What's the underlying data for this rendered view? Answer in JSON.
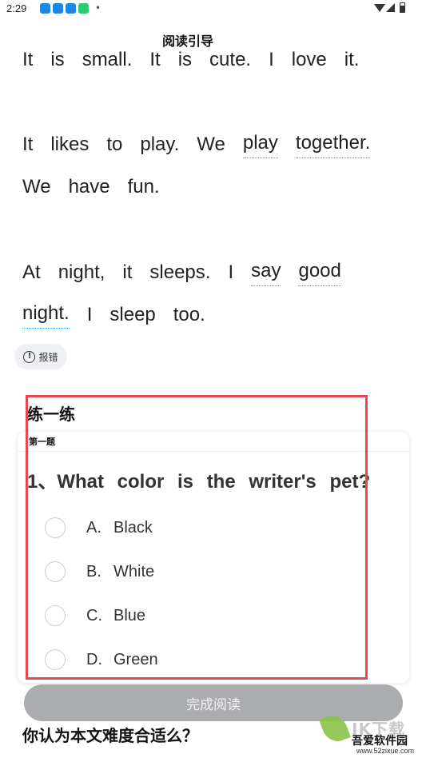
{
  "status_bar": {
    "time": "2:29",
    "dot": "•"
  },
  "header": {
    "title": "阅读引导"
  },
  "passage": {
    "lines": [
      {
        "words": [
          {
            "t": "It"
          },
          {
            "t": "is"
          },
          {
            "t": "small."
          },
          {
            "t": "It"
          },
          {
            "t": "is"
          },
          {
            "t": "cute."
          },
          {
            "t": "I"
          },
          {
            "t": "love"
          },
          {
            "t": "it."
          }
        ]
      },
      {
        "words": [
          {
            "t": "It"
          },
          {
            "t": "likes"
          },
          {
            "t": "to"
          },
          {
            "t": "play."
          },
          {
            "t": "We"
          },
          {
            "t": "play",
            "link": true
          },
          {
            "t": "together.",
            "link": true
          }
        ]
      },
      {
        "words": [
          {
            "t": "We"
          },
          {
            "t": "have"
          },
          {
            "t": "fun."
          }
        ]
      },
      {
        "words": [
          {
            "t": "At"
          },
          {
            "t": "night,"
          },
          {
            "t": "it"
          },
          {
            "t": "sleeps."
          },
          {
            "t": "I"
          },
          {
            "t": "say",
            "link": true
          },
          {
            "t": "good",
            "link": true
          }
        ]
      },
      {
        "words": [
          {
            "t": "night.",
            "link": true
          },
          {
            "t": "I"
          },
          {
            "t": "sleep"
          },
          {
            "t": "too."
          }
        ]
      }
    ]
  },
  "report": {
    "label": "报错"
  },
  "practice": {
    "title": "练一练",
    "question_index": "第一题",
    "question": "1、What color is the writer's pet?",
    "options": [
      {
        "letter": "A.",
        "text": "Black"
      },
      {
        "letter": "B.",
        "text": "White"
      },
      {
        "letter": "C.",
        "text": "Blue"
      },
      {
        "letter": "D.",
        "text": "Green"
      }
    ]
  },
  "finish_button": {
    "label": "完成阅读"
  },
  "difficulty": {
    "question": "你认为本文难度合适么？"
  },
  "watermark": {
    "big": "IK下载",
    "site": "吾爱软件园",
    "url": "www.52zixue.com"
  },
  "colors": {
    "highlight": "#e14a4f",
    "link_underline": "#4aa3df",
    "button_disabled": "#abacb0"
  }
}
